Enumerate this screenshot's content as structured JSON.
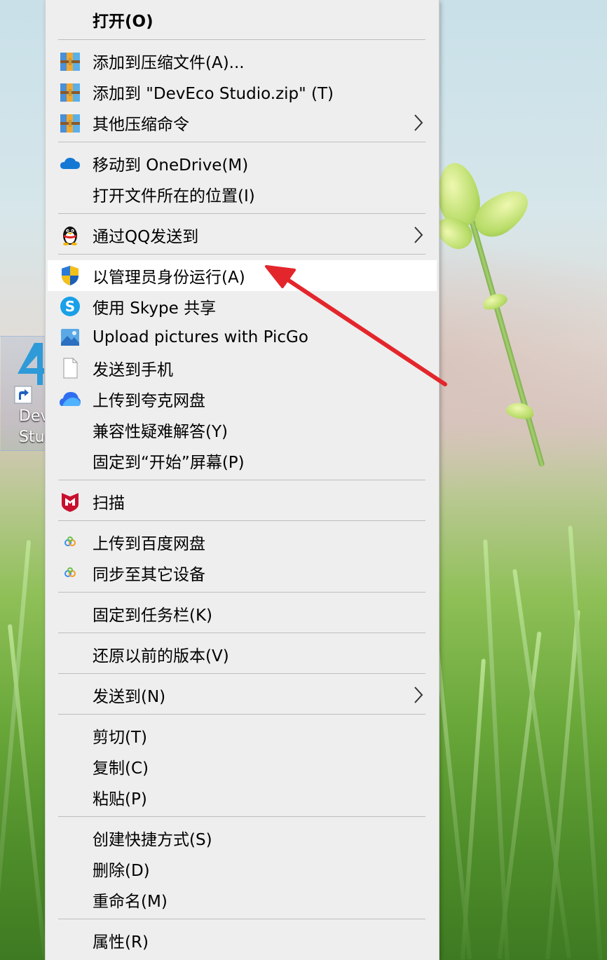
{
  "desktop": {
    "icon_label_line1": "DevEco",
    "icon_label_line2": "Studio"
  },
  "context_menu": {
    "items": [
      {
        "id": "open",
        "label": "打开(O)",
        "icon": "none",
        "bold": true,
        "submenu": false
      },
      {
        "id": "add-archive",
        "label": "添加到压缩文件(A)...",
        "icon": "winrar-books-icon",
        "submenu": false
      },
      {
        "id": "add-zip",
        "label": "添加到 \"DevEco Studio.zip\" (T)",
        "icon": "winrar-books-icon",
        "submenu": false
      },
      {
        "id": "other-compress",
        "label": "其他压缩命令",
        "icon": "winrar-books-icon",
        "submenu": true
      },
      {
        "id": "move-onedrive",
        "label": "移动到 OneDrive(M)",
        "icon": "onedrive-cloud-icon",
        "submenu": false
      },
      {
        "id": "open-location",
        "label": "打开文件所在的位置(I)",
        "icon": "none",
        "submenu": false
      },
      {
        "id": "send-qq",
        "label": "通过QQ发送到",
        "icon": "qq-penguin-icon",
        "submenu": true
      },
      {
        "id": "run-admin",
        "label": "以管理员身份运行(A)",
        "icon": "uac-shield-icon",
        "submenu": false,
        "highlighted": true
      },
      {
        "id": "skype-share",
        "label": "使用 Skype 共享",
        "icon": "skype-icon",
        "submenu": false
      },
      {
        "id": "picgo-upload",
        "label": "Upload pictures with PicGo",
        "icon": "picgo-icon",
        "submenu": false
      },
      {
        "id": "send-phone",
        "label": "发送到手机",
        "icon": "blank-page-icon",
        "submenu": false
      },
      {
        "id": "quark-upload",
        "label": "上传到夸克网盘",
        "icon": "quark-cloud-icon",
        "submenu": false
      },
      {
        "id": "compat-troubleshoot",
        "label": "兼容性疑难解答(Y)",
        "icon": "none",
        "submenu": false
      },
      {
        "id": "pin-start",
        "label": "固定到“开始”屏幕(P)",
        "icon": "none",
        "submenu": false
      },
      {
        "id": "scan",
        "label": "扫描",
        "icon": "mcafee-shield-icon",
        "submenu": false
      },
      {
        "id": "baidu-upload",
        "label": "上传到百度网盘",
        "icon": "baidu-netdisk-icon",
        "submenu": false
      },
      {
        "id": "sync-devices",
        "label": "同步至其它设备",
        "icon": "baidu-netdisk-icon",
        "submenu": false
      },
      {
        "id": "pin-taskbar",
        "label": "固定到任务栏(K)",
        "icon": "none",
        "submenu": false
      },
      {
        "id": "restore-versions",
        "label": "还原以前的版本(V)",
        "icon": "none",
        "submenu": false
      },
      {
        "id": "send-to",
        "label": "发送到(N)",
        "icon": "none",
        "submenu": true
      },
      {
        "id": "cut",
        "label": "剪切(T)",
        "icon": "none",
        "submenu": false
      },
      {
        "id": "copy",
        "label": "复制(C)",
        "icon": "none",
        "submenu": false
      },
      {
        "id": "paste",
        "label": "粘贴(P)",
        "icon": "none",
        "submenu": false
      },
      {
        "id": "create-shortcut",
        "label": "创建快捷方式(S)",
        "icon": "none",
        "submenu": false
      },
      {
        "id": "delete",
        "label": "删除(D)",
        "icon": "none",
        "submenu": false
      },
      {
        "id": "rename",
        "label": "重命名(M)",
        "icon": "none",
        "submenu": false
      },
      {
        "id": "properties",
        "label": "属性(R)",
        "icon": "none",
        "submenu": false
      }
    ]
  },
  "colors": {
    "menu_bg": "#eeeeee",
    "hover_bg": "#ffffff",
    "separator": "#bdbdbd",
    "annotation_arrow": "#e3262b"
  }
}
